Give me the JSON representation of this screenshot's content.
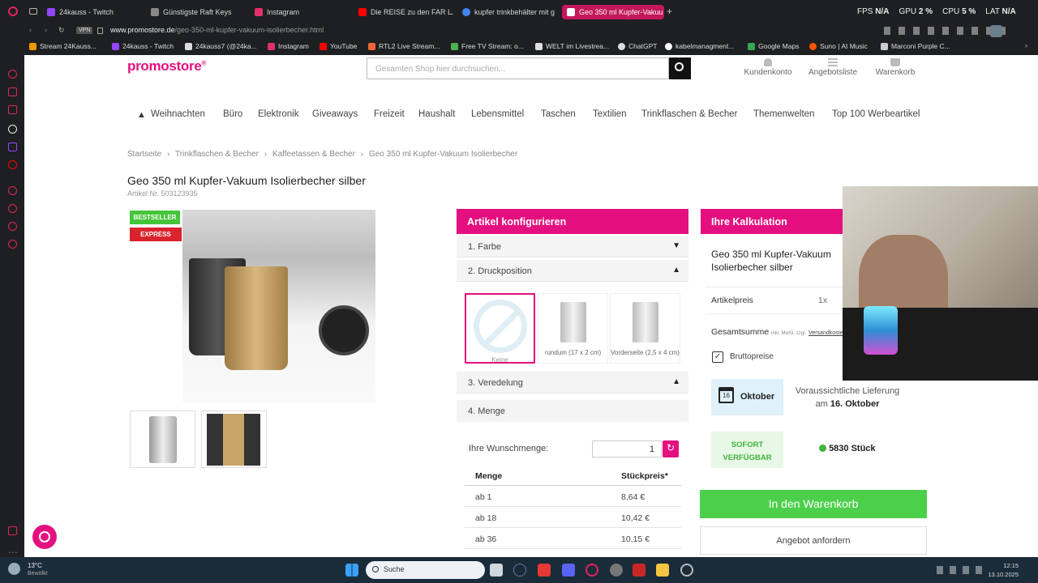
{
  "browser": {
    "tabs": [
      {
        "label": "24kauss - Twitch",
        "color": "#9146ff"
      },
      {
        "label": "Günstigste Raft Keys",
        "color": "#888888"
      },
      {
        "label": "Instagram",
        "color": "#e1306c"
      },
      {
        "label": "Die REISE zu den FAR LAN",
        "color": "#ff0000"
      },
      {
        "label": "kupfer trinkbehälter mit g",
        "color": "#4285f4"
      },
      {
        "label": "Geo 350 ml Kupfer-Vakuu",
        "color": "#e5107f"
      }
    ],
    "stats": {
      "fps_label": "FPS",
      "fps_value": "N/A",
      "gpu_label": "GPU",
      "gpu_value": "2 %",
      "cpu_label": "CPU",
      "cpu_value": "5 %",
      "lat_label": "LAT",
      "lat_value": "N/A"
    },
    "vpn_label": "VPN",
    "url_host": "www.promostore.de",
    "url_path": "/geo-350-ml-kupfer-vakuum-isolierbecher.html",
    "bookmarks": [
      "Stream 24Kauss...",
      "24kauss - Twitch",
      "24kauss7 (@24ka...",
      "Instagram",
      "YouTube",
      "RTL2 Live Stream...",
      "Free TV Stream: o...",
      "WELT im Livestrea...",
      "ChatGPT",
      "kabelmanagment...",
      "Google Maps",
      "Suno | AI Music",
      "Marconi Purple C..."
    ]
  },
  "site": {
    "logo": "promostore",
    "logo_mark": "®",
    "search_placeholder": "Gesamten Shop hier durchsuchen...",
    "header_links": [
      "Kundenkonto",
      "Angebotsliste",
      "Warenkorb"
    ],
    "nav": [
      "Weihnachten",
      "Büro",
      "Elektronik",
      "Giveaways",
      "Freizeit",
      "Haushalt",
      "Lebensmittel",
      "Taschen",
      "Textilien",
      "Trinkflaschen & Becher",
      "Themenwelten",
      "Top 100 Werbeartikel"
    ],
    "breadcrumb": [
      "Startseite",
      "Trinkflaschen & Becher",
      "Kaffeetassen & Becher",
      "Geo 350 ml Kupfer-Vakuum Isolierbecher"
    ],
    "breadcrumb_sep": "›",
    "product_title": "Geo 350 ml Kupfer-Vakuum Isolierbecher silber",
    "article_no": "Artikel Nr. 503123935",
    "badges": [
      "BESTSELLER",
      "EXPRESS"
    ],
    "configure": {
      "header": "Artikel konfigurieren",
      "sections": [
        "1. Farbe",
        "2. Druckposition",
        "3. Veredelung",
        "4. Menge"
      ],
      "print_options": [
        "Keine",
        "rundum (17 x 2 cm)",
        "Vorderseite (2,5 x 4 cm)"
      ],
      "quantity_label": "Ihre Wunschmenge:",
      "quantity_value": "1",
      "table_headers": [
        "Menge",
        "Stückpreis*"
      ],
      "table_rows": [
        {
          "qty": "ab 1",
          "price": "8,64 €"
        },
        {
          "qty": "ab 18",
          "price": "10,42 €"
        },
        {
          "qty": "ab 36",
          "price": "10,15 €"
        }
      ]
    },
    "calc": {
      "header": "Ihre Kalkulation",
      "product_name": "Geo 350 ml Kupfer-Vakuum Isolierbecher silber",
      "price_label": "Artikelpreis",
      "price_qty": "1x",
      "total_label": "Gesamtsumme",
      "total_note": "inkl. MwSt. zzgl.",
      "shipping_link": "Versandkosten",
      "brutto_label": "Bruttopreise",
      "calendar_day": "16",
      "month": "Oktober",
      "delivery_text": "Voraussichtliche Lieferung",
      "delivery_prefix": "am",
      "delivery_date": "16. Oktober",
      "stock_badge": "SOFORT VERFÜGBAR",
      "stock_count": "5830 Stück",
      "cart_button": "In den Warenkorb",
      "offer_button": "Angebot anfordern"
    }
  },
  "taskbar": {
    "temp": "13°C",
    "weather": "Bewölkt",
    "search": "Suche",
    "time": "12:15",
    "date": "13.10.2025"
  }
}
